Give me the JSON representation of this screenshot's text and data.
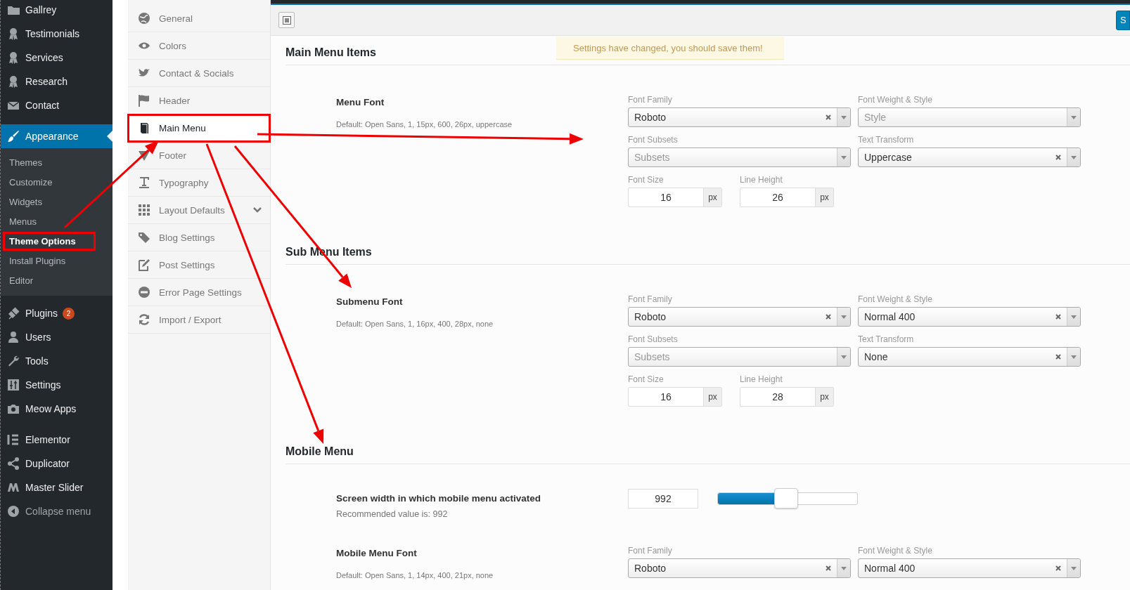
{
  "admin_menu": {
    "items": [
      {
        "label": "Gallrey",
        "selected": false
      },
      {
        "label": "Testimonials",
        "selected": false
      },
      {
        "label": "Services",
        "selected": false
      },
      {
        "label": "Research",
        "selected": false
      },
      {
        "label": "Contact",
        "selected": false
      },
      {
        "label": "Appearance",
        "selected": true,
        "submenu": [
          {
            "label": "Themes",
            "selected": false,
            "annotated": false
          },
          {
            "label": "Customize",
            "selected": false,
            "annotated": false
          },
          {
            "label": "Widgets",
            "selected": false,
            "annotated": false
          },
          {
            "label": "Menus",
            "selected": false,
            "annotated": false
          },
          {
            "label": "Theme Options",
            "selected": true,
            "annotated": true
          },
          {
            "label": "Install Plugins",
            "selected": false,
            "annotated": false
          },
          {
            "label": "Editor",
            "selected": false,
            "annotated": false
          }
        ]
      },
      {
        "label": "Plugins",
        "selected": false,
        "badge": "2"
      },
      {
        "label": "Users",
        "selected": false
      },
      {
        "label": "Tools",
        "selected": false
      },
      {
        "label": "Settings",
        "selected": false
      },
      {
        "label": "Meow Apps",
        "selected": false
      },
      {
        "label": "Elementor",
        "selected": false
      },
      {
        "label": "Duplicator",
        "selected": false
      },
      {
        "label": "Master Slider",
        "selected": false
      }
    ],
    "collapse_label": "Collapse menu"
  },
  "options_nav": {
    "items": [
      {
        "label": "General",
        "selected": false,
        "has_submenu": false,
        "annotated": false
      },
      {
        "label": "Colors",
        "selected": false,
        "has_submenu": false,
        "annotated": false
      },
      {
        "label": "Contact & Socials",
        "selected": false,
        "has_submenu": false,
        "annotated": false
      },
      {
        "label": "Header",
        "selected": false,
        "has_submenu": false,
        "annotated": false
      },
      {
        "label": "Main Menu",
        "selected": true,
        "has_submenu": false,
        "annotated": true
      },
      {
        "label": "Footer",
        "selected": false,
        "has_submenu": false,
        "annotated": false
      },
      {
        "label": "Typography",
        "selected": false,
        "has_submenu": false,
        "annotated": false
      },
      {
        "label": "Layout Defaults",
        "selected": false,
        "has_submenu": true,
        "annotated": false
      },
      {
        "label": "Blog Settings",
        "selected": false,
        "has_submenu": false,
        "annotated": false
      },
      {
        "label": "Post Settings",
        "selected": false,
        "has_submenu": false,
        "annotated": false
      },
      {
        "label": "Error Page Settings",
        "selected": false,
        "has_submenu": false,
        "annotated": false
      },
      {
        "label": "Import / Export",
        "selected": false,
        "has_submenu": false,
        "annotated": false
      }
    ]
  },
  "toolbar": {
    "save_button": "S"
  },
  "notice": "Settings have changed, you should save them!",
  "sections": [
    {
      "heading": "Main Menu Items",
      "options": [
        {
          "kind": "font",
          "title": "Menu Font",
          "description": "Default: Open Sans, 1, 15px, 600, 26px, uppercase",
          "selects": [
            {
              "label": "Font Family",
              "value": "Roboto",
              "clearable": true
            },
            {
              "label": "Font Weight & Style",
              "placeholder": "Style",
              "clearable": false
            },
            {
              "label": "Font Subsets",
              "placeholder": "Subsets",
              "clearable": false
            },
            {
              "label": "Text Transform",
              "value": "Uppercase",
              "clearable": true
            }
          ],
          "sizes": [
            {
              "label": "Font Size",
              "value": "16",
              "unit": "px"
            },
            {
              "label": "Line Height",
              "value": "26",
              "unit": "px"
            }
          ]
        }
      ]
    },
    {
      "heading": "Sub Menu Items",
      "options": [
        {
          "kind": "font",
          "title": "Submenu Font",
          "description": "Default: Open Sans, 1, 16px, 400, 28px, none",
          "selects": [
            {
              "label": "Font Family",
              "value": "Roboto",
              "clearable": true
            },
            {
              "label": "Font Weight & Style",
              "value": "Normal 400",
              "clearable": true
            },
            {
              "label": "Font Subsets",
              "placeholder": "Subsets",
              "clearable": false
            },
            {
              "label": "Text Transform",
              "value": "None",
              "clearable": true
            }
          ],
          "sizes": [
            {
              "label": "Font Size",
              "value": "16",
              "unit": "px"
            },
            {
              "label": "Line Height",
              "value": "28",
              "unit": "px"
            }
          ]
        }
      ]
    },
    {
      "heading": "Mobile Menu",
      "options": [
        {
          "kind": "slider",
          "title": "Screen width in which mobile menu activated",
          "description": "Recommended value is: 992",
          "value": "992",
          "level": 0.49
        },
        {
          "kind": "font",
          "title": "Mobile Menu Font",
          "description": "Default: Open Sans, 1, 14px, 400, 21px, none",
          "selects": [
            {
              "label": "Font Family",
              "value": "Roboto",
              "clearable": true
            },
            {
              "label": "Font Weight & Style",
              "value": "Normal 400",
              "clearable": true
            }
          ]
        }
      ]
    }
  ]
}
